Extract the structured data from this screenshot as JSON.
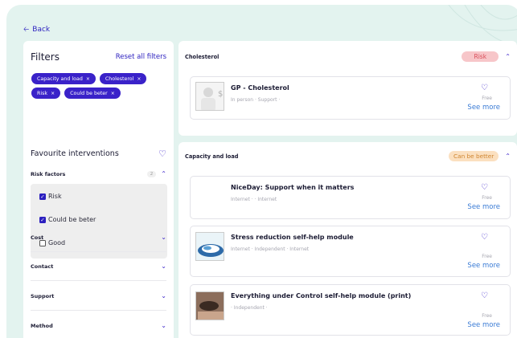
{
  "nav": {
    "back_label": "Back"
  },
  "filters": {
    "title": "Filters",
    "reset_label": "Reset all filters",
    "chips": [
      "Capacity and load",
      "Cholesterol",
      "Risk",
      "Could be beter"
    ],
    "favourite_label": "Favourite interventions",
    "risk_factors": {
      "label": "Risk factors",
      "count": "2",
      "options": [
        {
          "label": "Risk",
          "checked": true
        },
        {
          "label": "Could be beter",
          "checked": true
        },
        {
          "label": "Good",
          "checked": false
        }
      ]
    },
    "sections": [
      "Cost",
      "Contact",
      "Support",
      "Method"
    ]
  },
  "groups": [
    {
      "title": "Cholesterol",
      "status": "Risk",
      "items": [
        {
          "title": "GP - Cholesterol",
          "meta": "In person · Support ·",
          "price": "Free",
          "more": "See more"
        }
      ]
    },
    {
      "title": "Capacity and load",
      "status": "Can be better",
      "items": [
        {
          "title": "NiceDay: Support when it matters",
          "meta": "Internet · · Internet",
          "price": "Free",
          "more": "See more"
        },
        {
          "title": "Stress reduction self-help module",
          "meta": "Internet · Independent · Internet",
          "price": "Free",
          "more": "See more"
        },
        {
          "title": "Everything under Control self-help module (print)",
          "meta": "· Independent ·",
          "price": "Free",
          "more": "See more"
        }
      ]
    }
  ],
  "colors": {
    "accent": "#3a22c9",
    "background": "#e3f3ef",
    "risk": "#d84b57",
    "better": "#cf8530",
    "link": "#3a7bd5"
  }
}
